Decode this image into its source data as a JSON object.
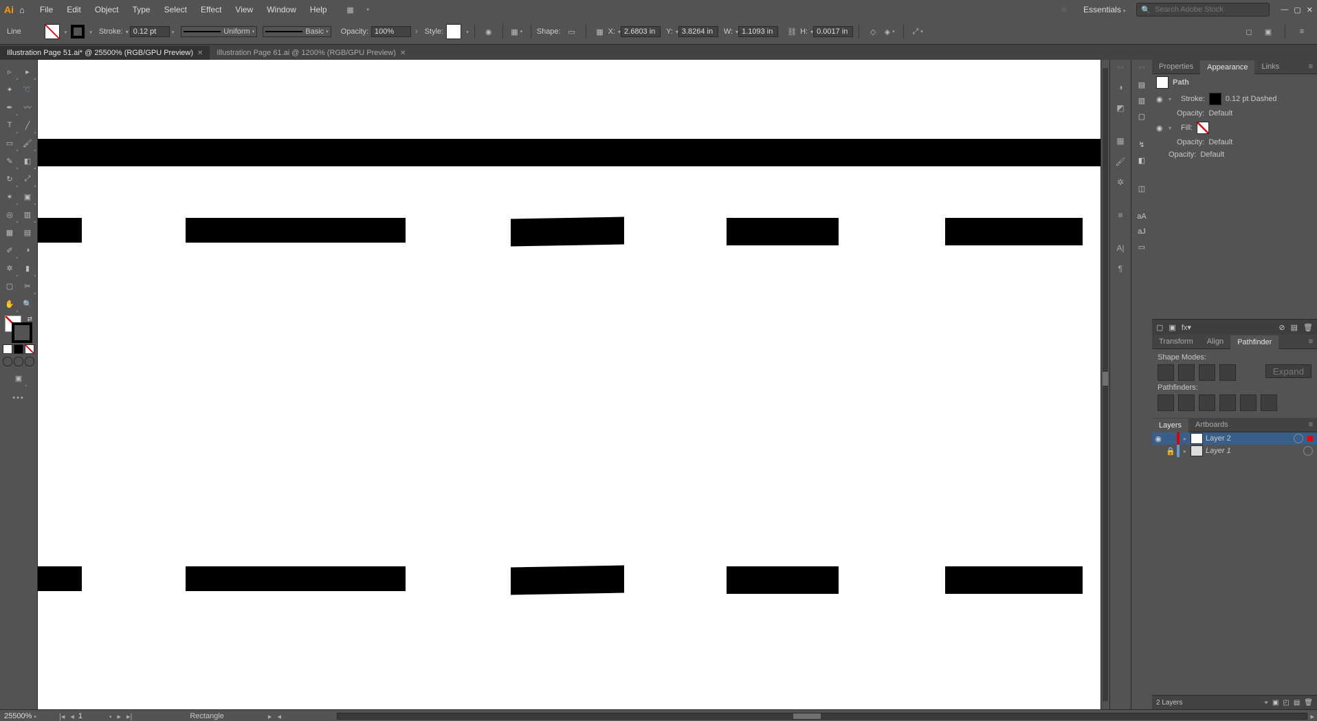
{
  "menubar": {
    "items": [
      "File",
      "Edit",
      "Object",
      "Type",
      "Select",
      "Effect",
      "View",
      "Window",
      "Help"
    ],
    "workspace": "Essentials",
    "search_placeholder": "Search Adobe Stock"
  },
  "controlbar": {
    "object_type": "Line",
    "stroke_label": "Stroke:",
    "stroke_value": "0.12 pt",
    "profile_label": "Uniform",
    "brush_label": "Basic",
    "opacity_label": "Opacity:",
    "opacity_value": "100%",
    "style_label": "Style:",
    "shape_label": "Shape:",
    "x_label": "X:",
    "x_value": "2.6803 in",
    "y_label": "Y:",
    "y_value": "3.8264 in",
    "w_label": "W:",
    "w_value": "1.1093 in",
    "h_label": "H:",
    "h_value": "0.0017 in"
  },
  "tabs": [
    {
      "title": "Illustration Page 51.ai* @ 25500% (RGB/GPU Preview)",
      "active": true
    },
    {
      "title": "Illustration Page 61.ai @ 1200% (RGB/GPU Preview)",
      "active": false
    }
  ],
  "appearance": {
    "tabs": [
      "Properties",
      "Appearance",
      "Links"
    ],
    "active_tab": "Appearance",
    "object": "Path",
    "rows": {
      "stroke_label": "Stroke:",
      "stroke_value": "0.12 pt Dashed",
      "opacity_label": "Opacity:",
      "opacity_default": "Default",
      "fill_label": "Fill:"
    }
  },
  "pathfinder": {
    "tabs": [
      "Transform",
      "Align",
      "Pathfinder"
    ],
    "active_tab": "Pathfinder",
    "shape_modes": "Shape Modes:",
    "pathfinders": "Pathfinders:",
    "expand": "Expand"
  },
  "layers": {
    "tabs": [
      "Layers",
      "Artboards"
    ],
    "active_tab": "Layers",
    "items": [
      {
        "name": "Layer 2",
        "color": "#e00000",
        "locked": false,
        "visible": true,
        "selected": true,
        "italic": false
      },
      {
        "name": "Layer 1",
        "color": "#5aa0d8",
        "locked": true,
        "visible": false,
        "selected": false,
        "italic": true
      }
    ],
    "count_label": "2 Layers"
  },
  "statusbar": {
    "zoom": "25500%",
    "artboard": "1",
    "selection": "Rectangle"
  }
}
